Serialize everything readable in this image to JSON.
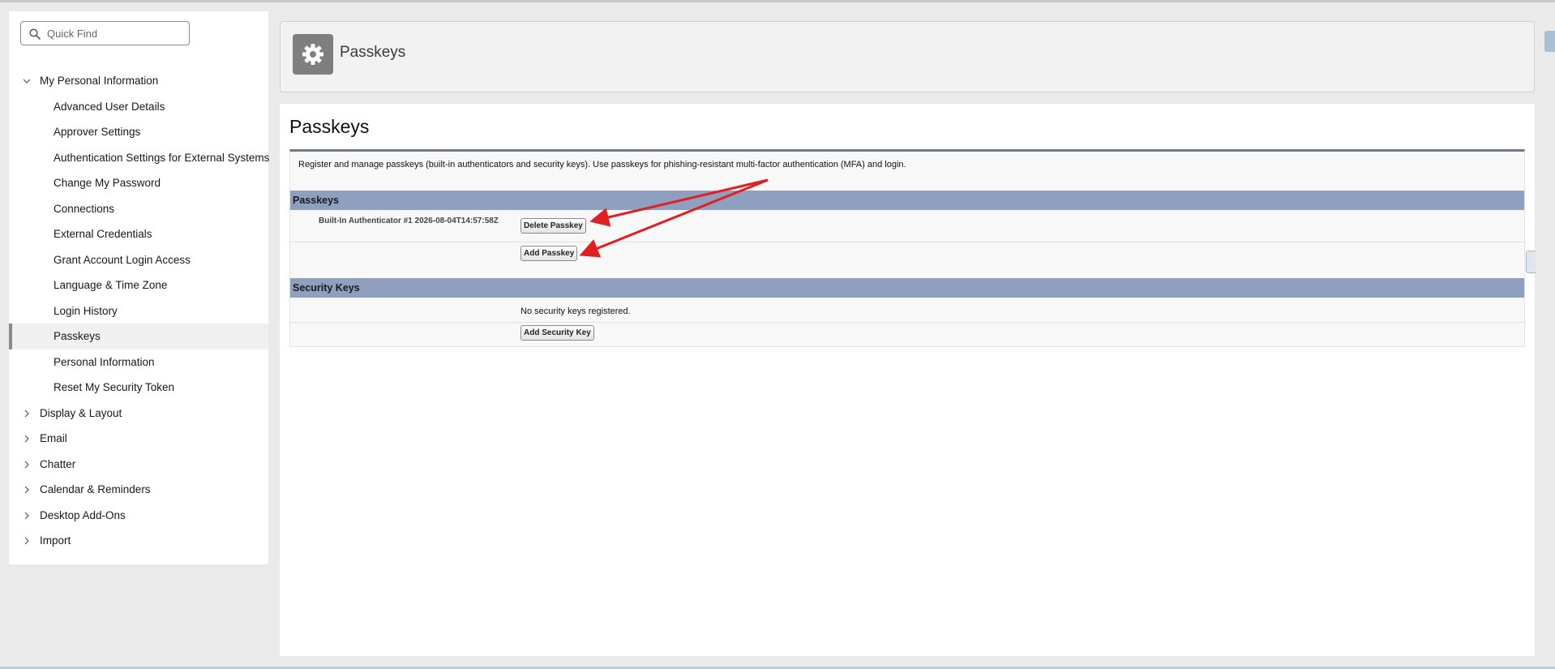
{
  "sidebar": {
    "search": {
      "placeholder": "Quick Find"
    },
    "items": [
      {
        "label": "My Personal Information",
        "state": "expanded"
      },
      {
        "label": "Advanced User Details"
      },
      {
        "label": "Approver Settings"
      },
      {
        "label": "Authentication Settings for External Systems"
      },
      {
        "label": "Change My Password"
      },
      {
        "label": "Connections"
      },
      {
        "label": "External Credentials"
      },
      {
        "label": "Grant Account Login Access"
      },
      {
        "label": "Language & Time Zone"
      },
      {
        "label": "Login History"
      },
      {
        "label": "Passkeys",
        "selected": true
      },
      {
        "label": "Personal Information"
      },
      {
        "label": "Reset My Security Token"
      },
      {
        "label": "Display & Layout",
        "state": "collapsed"
      },
      {
        "label": "Email",
        "state": "collapsed"
      },
      {
        "label": "Chatter",
        "state": "collapsed"
      },
      {
        "label": "Calendar & Reminders",
        "state": "collapsed"
      },
      {
        "label": "Desktop Add-Ons",
        "state": "collapsed"
      },
      {
        "label": "Import",
        "state": "collapsed"
      }
    ]
  },
  "header": {
    "title": "Passkeys",
    "icon": "gear-icon"
  },
  "main": {
    "title": "Passkeys",
    "description": "Register and manage passkeys (built-in authenticators and security keys). Use passkeys for phishing-resistant multi-factor authentication (MFA) and login.",
    "passkeys_section": {
      "title": "Passkeys",
      "entry_label": "Built-In Authenticator #1 2026-08-04T14:57:58Z",
      "delete_button": "Delete Passkey",
      "add_button": "Add Passkey"
    },
    "security_keys_section": {
      "title": "Security Keys",
      "empty_text": "No security keys registered.",
      "add_button": "Add Security Key"
    }
  },
  "colors": {
    "section_band": "#8f9fbf",
    "annotation_arrow": "#e02020",
    "selected_indicator": "#8a8a8a"
  }
}
